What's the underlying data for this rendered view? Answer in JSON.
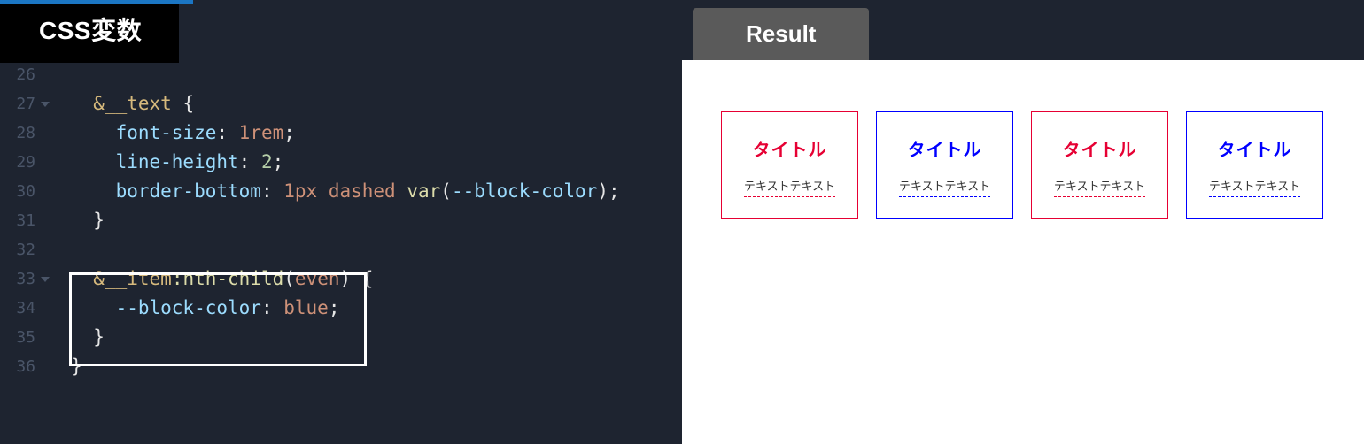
{
  "tabs": {
    "left_label": "CSS変数",
    "result_label": "Result"
  },
  "code": {
    "lines": {
      "26": "26",
      "27": "27",
      "28": "28",
      "29": "29",
      "30": "30",
      "31": "31",
      "32": "32",
      "33": "33",
      "34": "34",
      "35": "35",
      "36": "36"
    },
    "l27": {
      "sel": "&__text",
      "brace": "{"
    },
    "l28": {
      "prop": "font-size",
      "val": "1rem"
    },
    "l29": {
      "prop": "line-height",
      "val": "2"
    },
    "l30": {
      "prop": "border-bottom",
      "px": "1px",
      "dash": "dashed",
      "func": "var",
      "arg": "--block-color"
    },
    "l31": {
      "brace": "}"
    },
    "l33": {
      "sel": "&__item",
      "pseudo": ":nth-child",
      "arg": "even",
      "brace": "{"
    },
    "l34": {
      "prop": "--block-color",
      "val": "blue"
    },
    "l35": {
      "brace": "}"
    },
    "l36": {
      "brace": "}"
    }
  },
  "result": {
    "cards": [
      {
        "title": "タイトル",
        "text": "テキストテキスト"
      },
      {
        "title": "タイトル",
        "text": "テキストテキスト"
      },
      {
        "title": "タイトル",
        "text": "テキストテキスト"
      },
      {
        "title": "タイトル",
        "text": "テキストテキスト"
      }
    ]
  }
}
